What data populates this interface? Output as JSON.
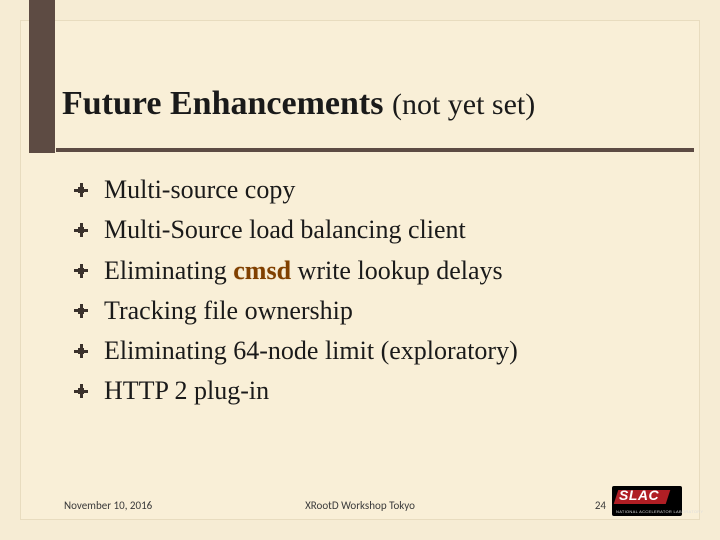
{
  "title": {
    "main": "Future Enhancements",
    "annot": "(not yet set)"
  },
  "bullets": [
    {
      "pre": "Multi-source copy",
      "code": "",
      "post": ""
    },
    {
      "pre": "Multi-Source load balancing client",
      "code": "",
      "post": ""
    },
    {
      "pre": "Eliminating ",
      "code": "cmsd",
      "post": " write lookup delays"
    },
    {
      "pre": "Tracking file ownership",
      "code": "",
      "post": ""
    },
    {
      "pre": "Eliminating 64-node limit (exploratory)",
      "code": "",
      "post": ""
    },
    {
      "pre": "HTTP 2 plug-in",
      "code": "",
      "post": ""
    }
  ],
  "footer": {
    "date": "November 10, 2016",
    "center": "XRootD Workshop Tokyo",
    "page": "24"
  },
  "logo": {
    "text": "SLAC",
    "sub": "NATIONAL ACCELERATOR LABORATORY"
  }
}
